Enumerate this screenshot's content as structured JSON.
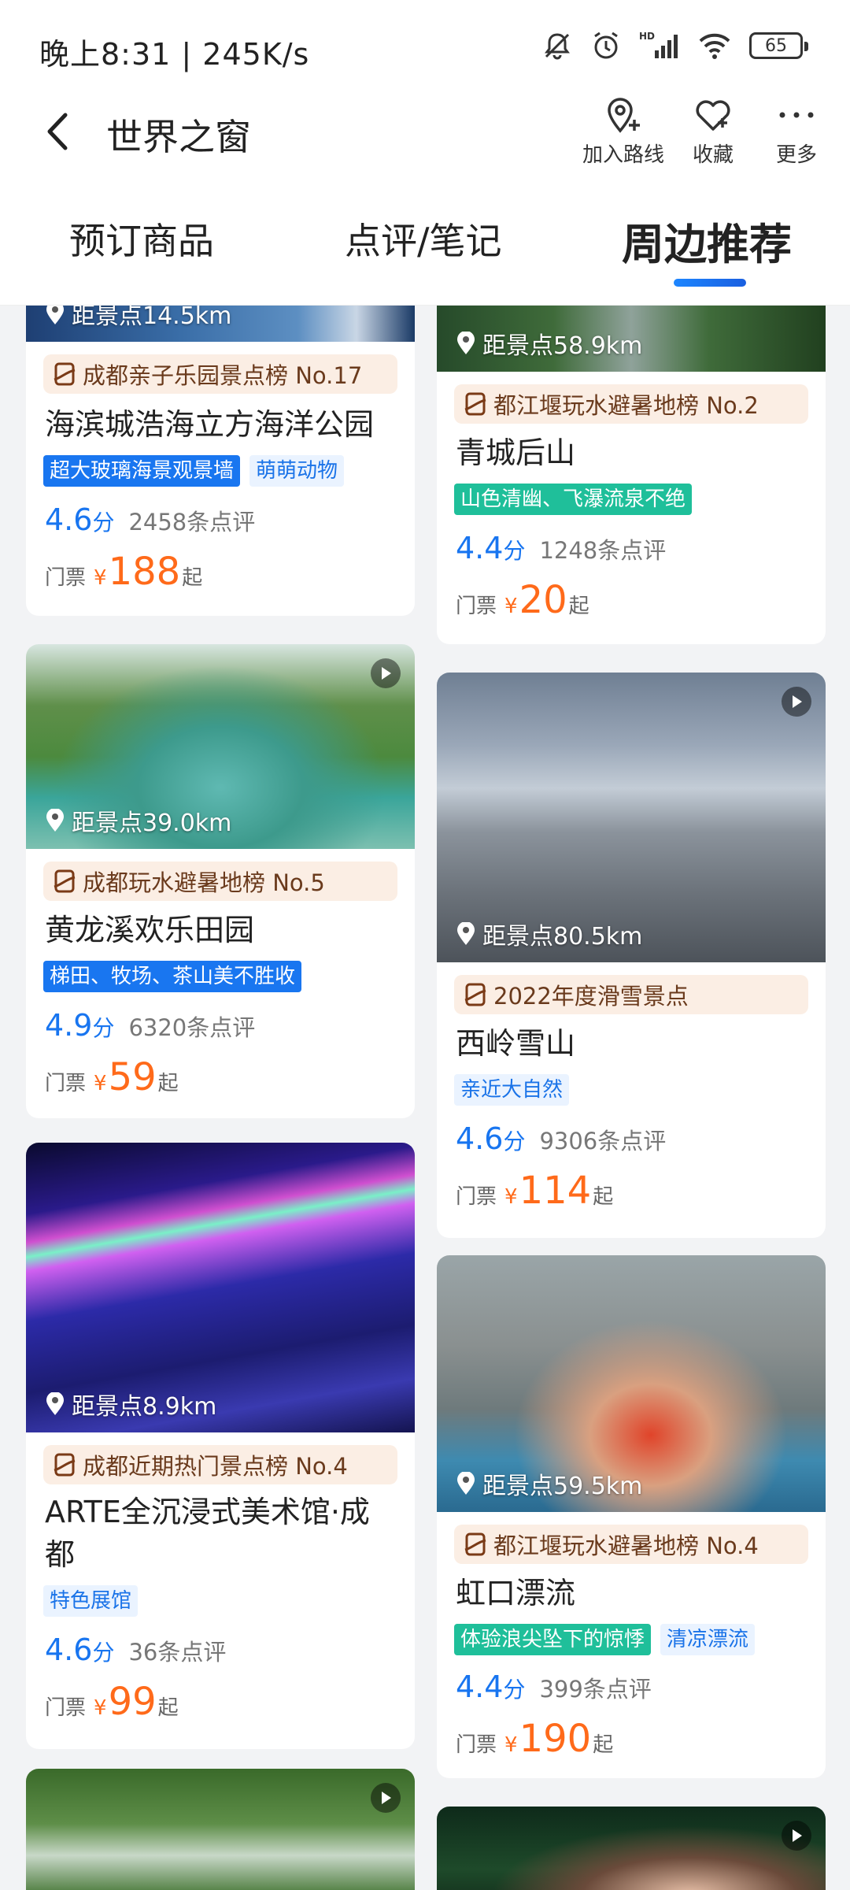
{
  "status_bar": {
    "time": "晚上8:31 | 245K/s",
    "battery": "65"
  },
  "header": {
    "title": "世界之窗",
    "actions": [
      {
        "label": "加入路线",
        "icon": "add-route-icon"
      },
      {
        "label": "收藏",
        "icon": "favorite-icon"
      },
      {
        "label": "更多",
        "icon": "more-icon"
      }
    ]
  },
  "tabs": [
    "预订商品",
    "点评/笔记",
    "周边推荐"
  ],
  "active_tab": "周边推荐",
  "labels": {
    "ticket_prefix": "门票",
    "yen": "¥",
    "from_suffix": "起",
    "score_unit": "分"
  },
  "cards": [
    {
      "distance": "距景点14.5km",
      "rank": "成都亲子乐园景点榜 No.17",
      "name": "海滨城浩海立方海洋公园",
      "tags": [
        {
          "text": "超大玻璃海景观景墙",
          "style": "blue"
        },
        {
          "text": "萌萌动物",
          "style": "light"
        }
      ],
      "score": "4.6",
      "reviews": "2458条点评",
      "price": "188"
    },
    {
      "distance": "距景点58.9km",
      "rank": "都江堰玩水避暑地榜 No.2",
      "name": "青城后山",
      "tags": [
        {
          "text": "山色清幽、飞瀑流泉不绝",
          "style": "blue"
        }
      ],
      "score": "4.4",
      "reviews": "1248条点评",
      "price": "20"
    },
    {
      "distance": "距景点39.0km",
      "rank": "成都玩水避暑地榜 No.5",
      "name": "黄龙溪欢乐田园",
      "tags": [
        {
          "text": "梯田、牧场、茶山美不胜收",
          "style": "blue"
        }
      ],
      "score": "4.9",
      "reviews": "6320条点评",
      "price": "59"
    },
    {
      "distance": "距景点80.5km",
      "rank": "2022年度滑雪景点",
      "name": "西岭雪山",
      "tags": [
        {
          "text": "亲近大自然",
          "style": "light"
        }
      ],
      "score": "4.6",
      "reviews": "9306条点评",
      "price": "114"
    },
    {
      "distance": "距景点8.9km",
      "rank": "成都近期热门景点榜 No.4",
      "name": "ARTE全沉浸式美术馆·成都",
      "tags": [
        {
          "text": "特色展馆",
          "style": "light"
        }
      ],
      "score": "4.6",
      "reviews": "36条点评",
      "price": "99"
    },
    {
      "distance": "距景点59.5km",
      "rank": "都江堰玩水避暑地榜 No.4",
      "name": "虹口漂流",
      "tags": [
        {
          "text": "体验浪尖坠下的惊悸",
          "style": "green"
        },
        {
          "text": "清凉漂流",
          "style": "light"
        }
      ],
      "score": "4.4",
      "reviews": "399条点评",
      "price": "190"
    }
  ]
}
